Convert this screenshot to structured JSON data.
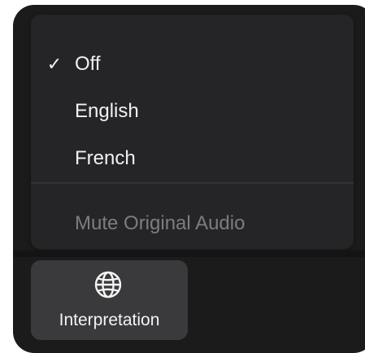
{
  "menu": {
    "items": [
      {
        "label": "Off",
        "checked": true,
        "check_glyph": "✓"
      },
      {
        "label": "English",
        "checked": false
      },
      {
        "label": "French",
        "checked": false
      }
    ],
    "mute_option": {
      "label": "Mute Original Audio",
      "enabled": false
    }
  },
  "toolbar": {
    "interpretation_label": "Interpretation",
    "interpretation_icon": "globe-icon"
  },
  "colors": {
    "window_bg": "#1b1b1c",
    "menu_bg": "#252527",
    "text": "#f1f1f1",
    "disabled_text": "#7d7d80",
    "button_bg": "#3a3a3c"
  }
}
